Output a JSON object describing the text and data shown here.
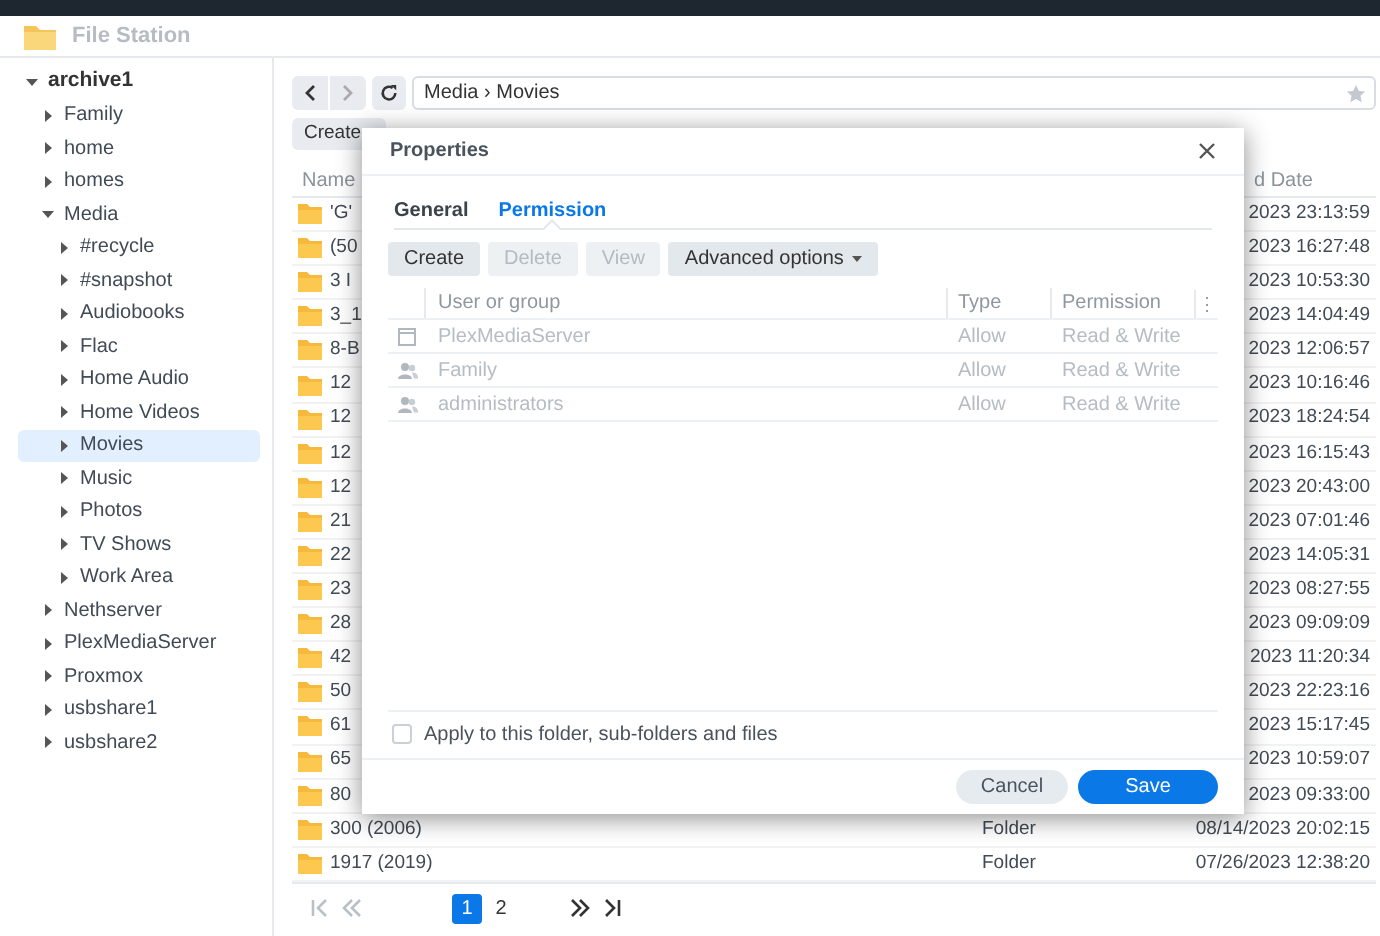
{
  "window": {
    "title": "File Station"
  },
  "sidebar": {
    "items": [
      {
        "label": "archive1",
        "expanded": true,
        "selected": false,
        "children": [
          {
            "label": "Family",
            "expanded": false,
            "selected": false
          },
          {
            "label": "home",
            "expanded": false,
            "selected": false
          },
          {
            "label": "homes",
            "expanded": false,
            "selected": false
          },
          {
            "label": "Media",
            "expanded": true,
            "selected": false,
            "children": [
              {
                "label": "#recycle",
                "expanded": false,
                "selected": false
              },
              {
                "label": "#snapshot",
                "expanded": false,
                "selected": false
              },
              {
                "label": "Audiobooks",
                "expanded": false,
                "selected": false
              },
              {
                "label": "Flac",
                "expanded": false,
                "selected": false
              },
              {
                "label": "Home Audio",
                "expanded": false,
                "selected": false
              },
              {
                "label": "Home Videos",
                "expanded": false,
                "selected": false
              },
              {
                "label": "Movies",
                "expanded": false,
                "selected": true
              },
              {
                "label": "Music",
                "expanded": false,
                "selected": false
              },
              {
                "label": "Photos",
                "expanded": false,
                "selected": false
              },
              {
                "label": "TV Shows",
                "expanded": false,
                "selected": false
              },
              {
                "label": "Work Area",
                "expanded": false,
                "selected": false
              }
            ]
          },
          {
            "label": "Nethserver",
            "expanded": false,
            "selected": false
          },
          {
            "label": "PlexMediaServer",
            "expanded": false,
            "selected": false
          },
          {
            "label": "Proxmox",
            "expanded": false,
            "selected": false
          },
          {
            "label": "usbshare1",
            "expanded": false,
            "selected": false
          },
          {
            "label": "usbshare2",
            "expanded": false,
            "selected": false
          }
        ]
      }
    ]
  },
  "path": "Media › Movies",
  "toolbar": {
    "buttons": [
      "Create"
    ]
  },
  "file_list": {
    "columns": [
      "Name",
      "d Date"
    ],
    "rows": [
      {
        "name": "'G'",
        "date": "2023 23:13:59"
      },
      {
        "name": "(50",
        "date": "2023 16:27:48"
      },
      {
        "name": "3 I",
        "date": "2023 10:53:30"
      },
      {
        "name": "3_1",
        "date": "2023 14:04:49"
      },
      {
        "name": "8-B",
        "date": "2023 12:06:57"
      },
      {
        "name": "12",
        "date": "2023 10:16:46"
      },
      {
        "name": "12",
        "date": "2023 18:24:54"
      },
      {
        "name": "12",
        "date": "2023 16:15:43"
      },
      {
        "name": "12",
        "date": "2023 20:43:00"
      },
      {
        "name": "21",
        "date": "2023 07:01:46"
      },
      {
        "name": "22",
        "date": "2023 14:05:31"
      },
      {
        "name": "23",
        "date": "2023 08:27:55"
      },
      {
        "name": "28",
        "date": "2023 09:09:09"
      },
      {
        "name": "42",
        "date": "2023 11:20:34"
      },
      {
        "name": "50",
        "date": "2023 22:23:16"
      },
      {
        "name": "61",
        "date": "2023 15:17:45"
      },
      {
        "name": "65",
        "date": "2023 10:59:07"
      },
      {
        "name": "80",
        "date": "2023 09:33:00"
      },
      {
        "name": "300 (2006)",
        "type": "Folder",
        "date": "08/14/2023 20:02:15"
      },
      {
        "name": "1917 (2019)",
        "type": "Folder",
        "date": "07/26/2023 12:38:20"
      }
    ]
  },
  "pagination": {
    "pages": [
      {
        "label": "1",
        "selected": true
      },
      {
        "label": "2",
        "selected": false
      }
    ],
    "nav_buttons": [
      {
        "kind": "first",
        "disabled": true
      },
      {
        "kind": "prev",
        "disabled": true
      },
      {
        "kind": "next",
        "disabled": false
      },
      {
        "kind": "last",
        "disabled": false
      }
    ]
  },
  "dialog": {
    "title": "Properties",
    "tabs": [
      {
        "label": "General",
        "selected": false
      },
      {
        "label": "Permission",
        "selected": true
      }
    ],
    "buttons": [
      {
        "label": "Create",
        "disabled": false
      },
      {
        "label": "Delete",
        "disabled": true
      },
      {
        "label": "View",
        "disabled": true
      },
      {
        "label": "Advanced options",
        "disabled": false,
        "kind": "dropdown"
      }
    ],
    "columns": [
      "User or group",
      "Type",
      "Permission"
    ],
    "column_menu": "⋮",
    "rows": [
      {
        "kind": "user",
        "name": "PlexMediaServer",
        "type": "Allow",
        "permission": "Read & Write",
        "disabled": true
      },
      {
        "kind": "group",
        "name": "Family",
        "type": "Allow",
        "permission": "Read & Write",
        "disabled": true
      },
      {
        "kind": "group",
        "name": "administrators",
        "type": "Allow",
        "permission": "Read & Write",
        "disabled": true
      }
    ],
    "apply_checkbox": {
      "label": "Apply to this folder, sub-folders and files",
      "checked": false
    },
    "footer_buttons": [
      {
        "label": "Cancel",
        "kind": "secondary"
      },
      {
        "label": "Save",
        "kind": "primary"
      }
    ]
  }
}
